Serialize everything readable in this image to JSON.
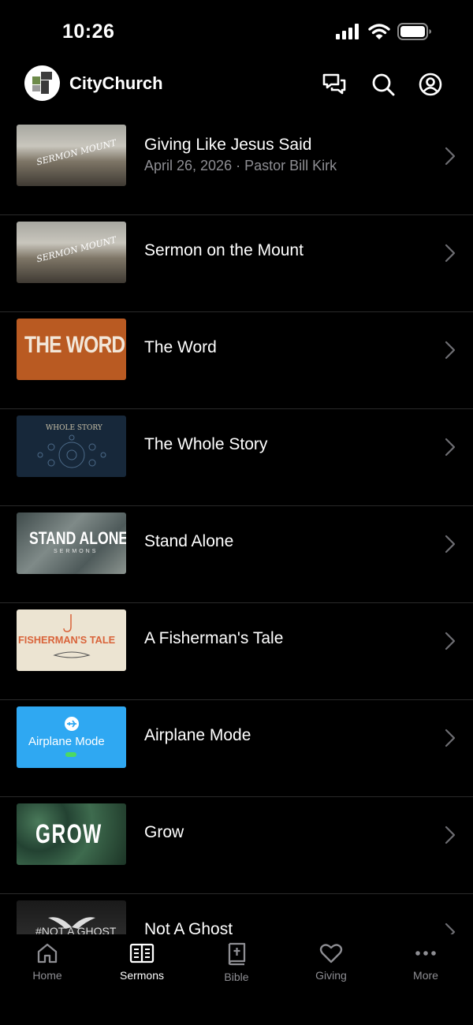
{
  "status": {
    "time": "10:26"
  },
  "header": {
    "brand": "CityChurch",
    "icons": [
      "chat-icon",
      "search-icon",
      "account-icon"
    ]
  },
  "sermons": [
    {
      "title": "Giving Like Jesus Said",
      "subtitle": "April 26, 2026 · Pastor Bill Kirk",
      "thumb_text": "SERMON MOUNT"
    },
    {
      "title": "Sermon on the Mount",
      "thumb_text": "SERMON MOUNT"
    },
    {
      "title": "The Word",
      "thumb_text": "THE WORD"
    },
    {
      "title": "The Whole Story",
      "thumb_text": "WHOLE STORY"
    },
    {
      "title": "Stand Alone",
      "thumb_text": "STAND ALONE",
      "thumb_sub": "SERMONS"
    },
    {
      "title": "A Fisherman's Tale",
      "thumb_text": "FISHERMAN'S TALE"
    },
    {
      "title": "Airplane Mode",
      "thumb_text": "Airplane Mode"
    },
    {
      "title": "Grow",
      "thumb_text": "GROW"
    },
    {
      "title": "Not A Ghost",
      "thumb_text": "#NOT A GHOST"
    }
  ],
  "tabs": [
    {
      "label": "Home",
      "icon": "home-icon"
    },
    {
      "label": "Sermons",
      "icon": "book-icon",
      "active": true
    },
    {
      "label": "Bible",
      "icon": "bible-icon"
    },
    {
      "label": "Giving",
      "icon": "heart-icon"
    },
    {
      "label": "More",
      "icon": "more-icon"
    }
  ],
  "colors": {
    "background": "#000000",
    "text": "#ffffff",
    "muted": "#8e8e93",
    "divider": "#2a2a2a"
  }
}
